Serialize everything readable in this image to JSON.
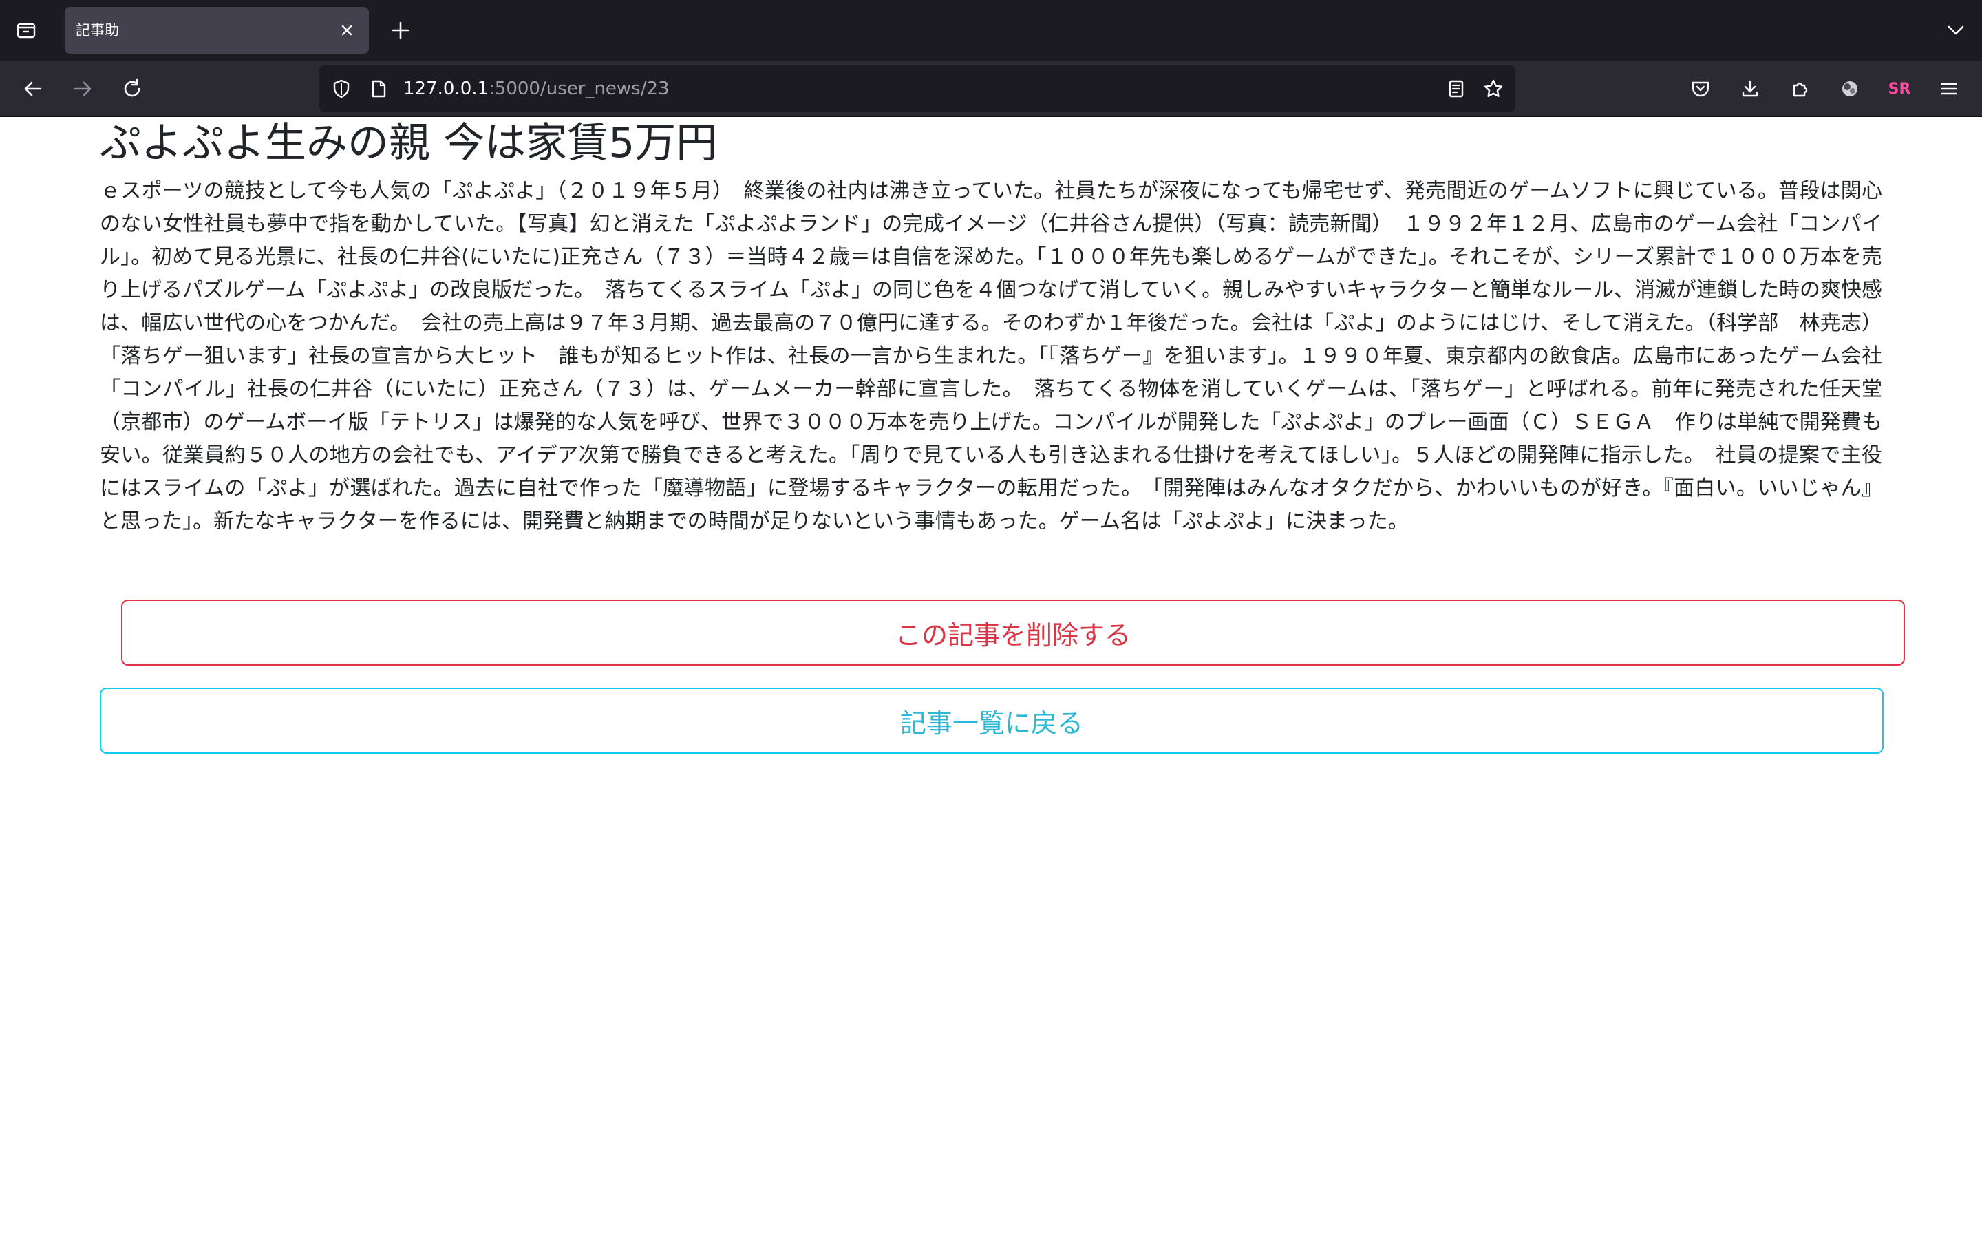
{
  "browser": {
    "tab_title": "記事助",
    "url_host": "127.0.0.1",
    "url_rest": ":5000/user_news/23",
    "profile_initials": "SR"
  },
  "article": {
    "title": "ぷよぷよ生みの親 今は家賃5万円",
    "body": "ｅスポーツの競技として今も人気の「ぷよぷよ」（２０１９年５月）　終業後の社内は沸き立っていた。社員たちが深夜になっても帰宅せず、発売間近のゲームソフトに興じている。普段は関心のない女性社員も夢中で指を動かしていた。【写真】幻と消えた「ぷよぷよランド」の完成イメージ（仁井谷さん提供）（写真：読売新聞）　１９９２年１２月、広島市のゲーム会社「コンパイル」。初めて見る光景に、社長の仁井谷(にいたに)正充さん（７３）＝当時４２歳＝は自信を深めた。「１０００年先も楽しめるゲームができた」。それこそが、シリーズ累計で１０００万本を売り上げるパズルゲーム「ぷよぷよ」の改良版だった。　落ちてくるスライム「ぷよ」の同じ色を４個つなげて消していく。親しみやすいキャラクターと簡単なルール、消滅が連鎖した時の爽快感は、幅広い世代の心をつかんだ。　会社の売上高は９７年３月期、過去最高の７０億円に達する。そのわずか１年後だった。会社は「ぷよ」のようにはじけ、そして消えた。（科学部　林尭志）「落ちゲー狙います」社長の宣言から大ヒット　誰もが知るヒット作は、社長の一言から生まれた。「『落ちゲー』を狙います」。１９９０年夏、東京都内の飲食店。広島市にあったゲーム会社「コンパイル」社長の仁井谷（にいたに）正充さん（７３）は、ゲームメーカー幹部に宣言した。　落ちてくる物体を消していくゲームは、「落ちゲー」と呼ばれる。前年に発売された任天堂（京都市）のゲームボーイ版「テトリス」は爆発的な人気を呼び、世界で３０００万本を売り上げた。コンパイルが開発した「ぷよぷよ」のプレー画面（Ｃ）ＳＥＧＡ　作りは単純で開発費も安い。従業員約５０人の地方の会社でも、アイデア次第で勝負できると考えた。「周りで見ている人も引き込まれる仕掛けを考えてほしい」。５人ほどの開発陣に指示した。　社員の提案で主役にはスライムの「ぷよ」が選ばれた。過去に自社で作った「魔導物語」に登場するキャラクターの転用だった。　「開発陣はみんなオタクだから、かわいいものが好き。『面白い。いいじゃん』と思った」。新たなキャラクターを作るには、開発費と納期までの時間が足りないという事情もあった。ゲーム名は「ぷよぷよ」に決まった。"
  },
  "actions": {
    "delete_label": "この記事を削除する",
    "back_label": "記事一覧に戻る"
  },
  "colors": {
    "danger": "#dc3545",
    "info": "#0dcaf0",
    "chrome_dark": "#1c1b22",
    "chrome_toolbar": "#2b2a33"
  }
}
